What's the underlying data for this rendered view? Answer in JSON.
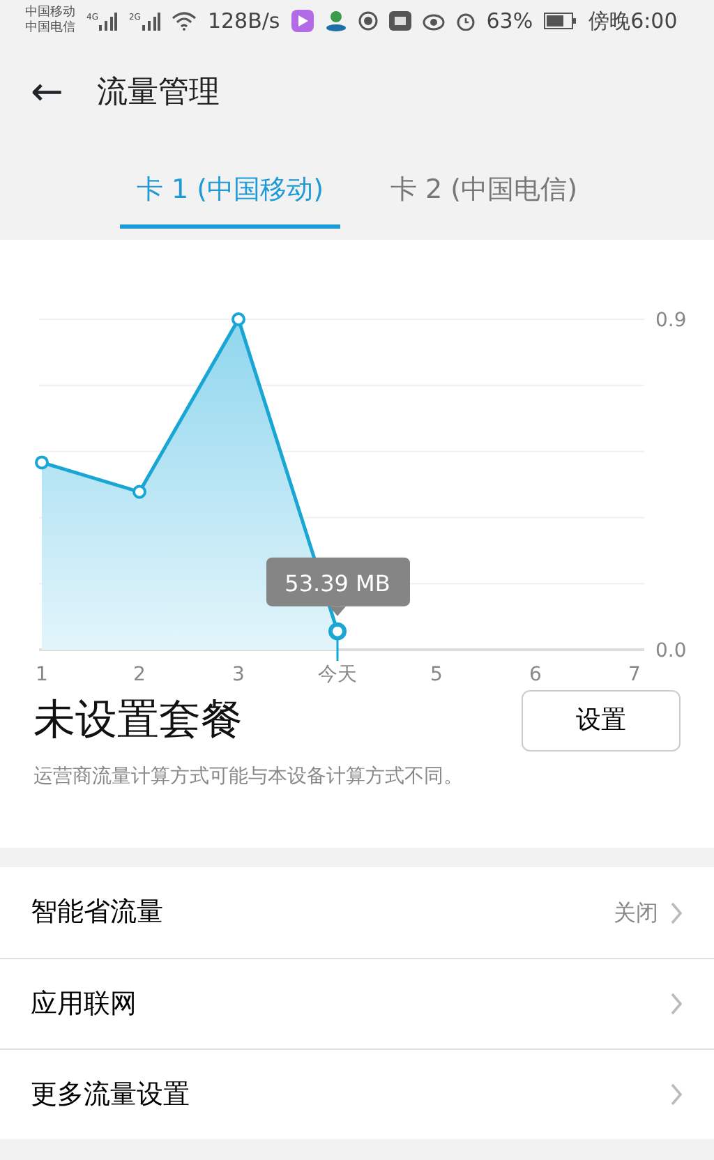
{
  "status_bar": {
    "carriers": [
      "中国移动",
      "中国电信"
    ],
    "signal_labels": [
      "4G",
      "2G"
    ],
    "speed": "128B/s",
    "battery_percent": "63%",
    "time": "傍晚6:00"
  },
  "header": {
    "back": "←",
    "title": "流量管理"
  },
  "tabs": [
    {
      "label": "卡 1 (中国移动)",
      "selected": true
    },
    {
      "label": "卡 2 (中国电信)",
      "selected": false
    }
  ],
  "usage": {
    "chart_data": {
      "type": "area",
      "categories": [
        "1",
        "2",
        "3",
        "今天",
        "5",
        "6",
        "7"
      ],
      "series": [
        {
          "color": "#1aa6d4",
          "values": [
            0.51,
            0.43,
            0.9,
            0.05,
            null,
            null,
            null
          ]
        }
      ],
      "ylim": [
        0,
        0.9
      ],
      "yticks": [
        {
          "value": 0,
          "label": "0.0"
        },
        {
          "value": 0.9,
          "label": "0.9"
        }
      ],
      "annotations": [
        {
          "x": "今天",
          "y": 0.05,
          "text": "53.39 MB"
        }
      ]
    }
  },
  "plan": {
    "title": "未设置套餐",
    "button": "设置",
    "note": "运营商流量计算方式可能与本设备计算方式不同。"
  },
  "settings": [
    {
      "label": "智能省流量",
      "value": "关闭"
    },
    {
      "label": "应用联网"
    },
    {
      "label": "更多流量设置"
    }
  ]
}
